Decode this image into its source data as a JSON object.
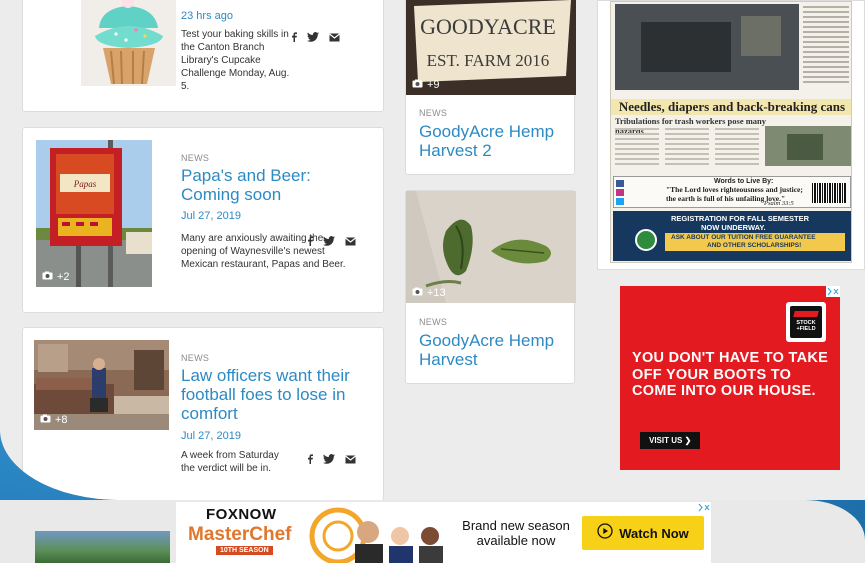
{
  "cupcake_article": {
    "time": "23 hrs ago",
    "description": "Test your baking skills in the Canton Branch Library's Cupcake Challenge Monday, Aug. 5."
  },
  "papas_article": {
    "category": "NEWS",
    "title": "Papa's and Beer: Coming soon",
    "date": "Jul 27, 2019",
    "description": "Many are anxiously awaiting the opening of Waynesville's newest Mexican restaurant, Papas and Beer.",
    "photo_count": "+2"
  },
  "law_article": {
    "category": "NEWS",
    "title": "Law officers want their football foes to lose in comfort",
    "date": "Jul 27, 2019",
    "description": "A week from Saturday the verdict will be in.",
    "photo_count": "+8"
  },
  "hemp2_article": {
    "category": "NEWS",
    "title": "GoodyAcre Hemp Harvest 2",
    "photo_count": "+9",
    "sign_line1": "GOODYACRE",
    "sign_line2": "EST. FARM 2016"
  },
  "hemp_article": {
    "category": "NEWS",
    "title": "GoodyAcre Hemp Harvest",
    "photo_count": "+13"
  },
  "newspaper": {
    "headline": "Needles, diapers and back-breaking cans",
    "subhead": "Tribulations for trash workers pose many hazards",
    "words_title": "Words to Live By:",
    "quote": "\"The Lord loves righteousness and justice; the earth is full of his unfailing love.\"",
    "quote_ref": "Psalm 33:5",
    "registration_line1": "REGISTRATION FOR FALL SEMESTER",
    "registration_line2": "NOW UNDERWAY.",
    "tuition_line1": "ASK ABOUT OUR TUITION FREE GUARANTEE",
    "tuition_line2": "AND OTHER SCHOLARSHIPS!"
  },
  "ad_stock_field": {
    "logo_text": "STOCK +FIELD",
    "headline": "YOU DON'T HAVE TO TAKE OFF YOUR BOOTS TO COME INTO OUR HOUSE.",
    "button": "VISIT US ❯"
  },
  "ad_foxnow": {
    "brand": "FOXNOW",
    "show": "MasterChef",
    "season": "10TH SEASON",
    "tagline": "Brand new season available now",
    "button": "Watch Now"
  },
  "colors": {
    "link": "#2d8ac3",
    "ad_red": "#e41a21",
    "watch_yellow": "#f7d117"
  }
}
